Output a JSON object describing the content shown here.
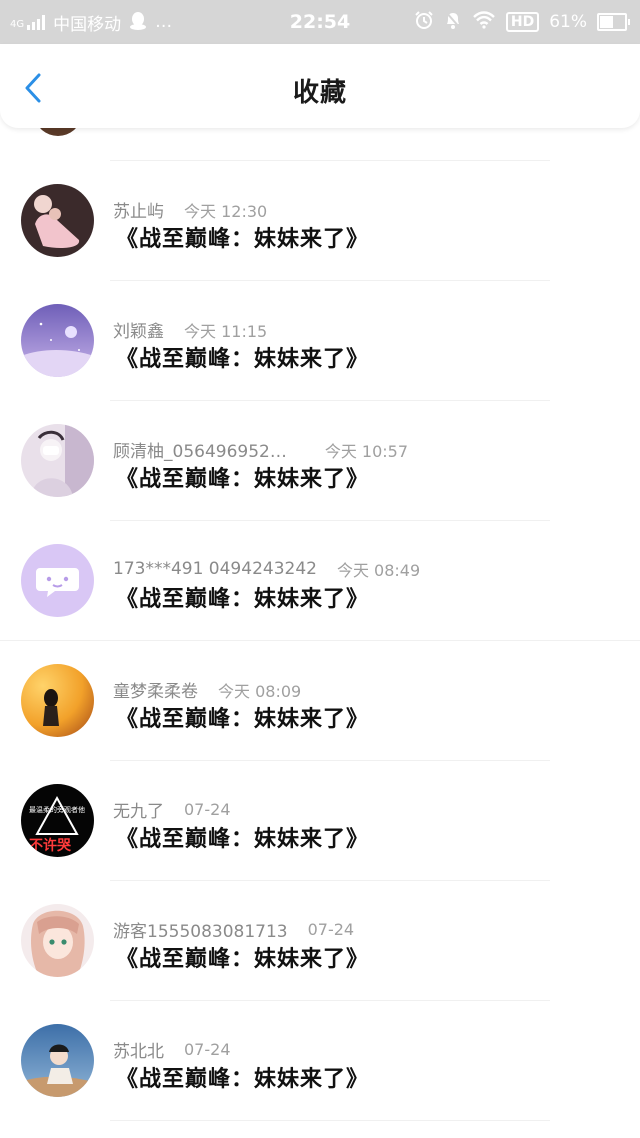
{
  "status_bar": {
    "network": "4G",
    "carrier": "中国移动",
    "more": "…",
    "time": "22:54",
    "hd": "HD",
    "battery_percent": "61%",
    "battery_level": 0.61
  },
  "header": {
    "title": "收藏",
    "back_icon": "chevron-left-icon",
    "accent_color": "#2b8fe6"
  },
  "items": [
    {
      "name": "苏止屿",
      "time": "今天 12:30",
      "title": "《战至巅峰：妹妹来了》"
    },
    {
      "name": "刘颖鑫",
      "time": "今天 11:15",
      "title": "《战至巅峰：妹妹来了》"
    },
    {
      "name": "顾清柚_056496952…",
      "time": "今天 10:57",
      "title": "《战至巅峰：妹妹来了》"
    },
    {
      "name": "173***491 0494243242",
      "time": "今天 08:49",
      "title": "《战至巅峰：妹妹来了》"
    },
    {
      "name": "童梦柔柔卷",
      "time": "今天 08:09",
      "title": "《战至巅峰：妹妹来了》"
    },
    {
      "name": "无九了",
      "time": "07-24",
      "title": "《战至巅峰：妹妹来了》"
    },
    {
      "name": "游客1555083081713",
      "time": "07-24",
      "title": "《战至巅峰：妹妹来了》"
    },
    {
      "name": "苏北北",
      "time": "07-24",
      "title": "《战至巅峰：妹妹来了》"
    }
  ],
  "avatar_text": {
    "item_6_line1": "最温柔的旁观者他",
    "item_6_line2": "不许哭"
  }
}
